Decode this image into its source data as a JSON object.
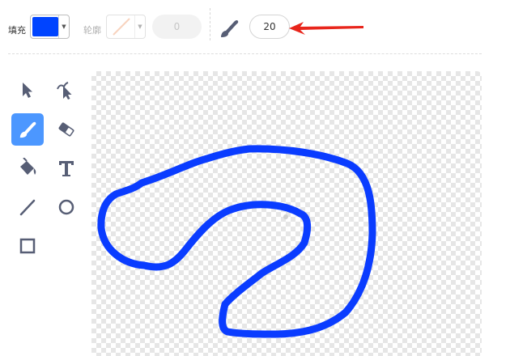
{
  "toolbar": {
    "fill_label": "填充",
    "fill_color": "#0044ff",
    "outline_label": "轮廓",
    "outline_width": "0",
    "brush_size": "20"
  },
  "colors": {
    "accent": "#4c97ff",
    "stroke": "#0a3cff",
    "annotation_arrow": "#e8251b",
    "icon": "#575e75"
  },
  "tools": [
    {
      "name": "select",
      "icon": "arrow-cursor-icon"
    },
    {
      "name": "reshape",
      "icon": "reshape-cursor-icon"
    },
    {
      "name": "brush",
      "icon": "brush-icon",
      "active": true
    },
    {
      "name": "eraser",
      "icon": "eraser-icon"
    },
    {
      "name": "fill",
      "icon": "fill-bucket-icon"
    },
    {
      "name": "text",
      "icon": "text-icon"
    },
    {
      "name": "line",
      "icon": "line-icon"
    },
    {
      "name": "circle",
      "icon": "circle-icon"
    },
    {
      "name": "rectangle",
      "icon": "rectangle-icon"
    }
  ]
}
